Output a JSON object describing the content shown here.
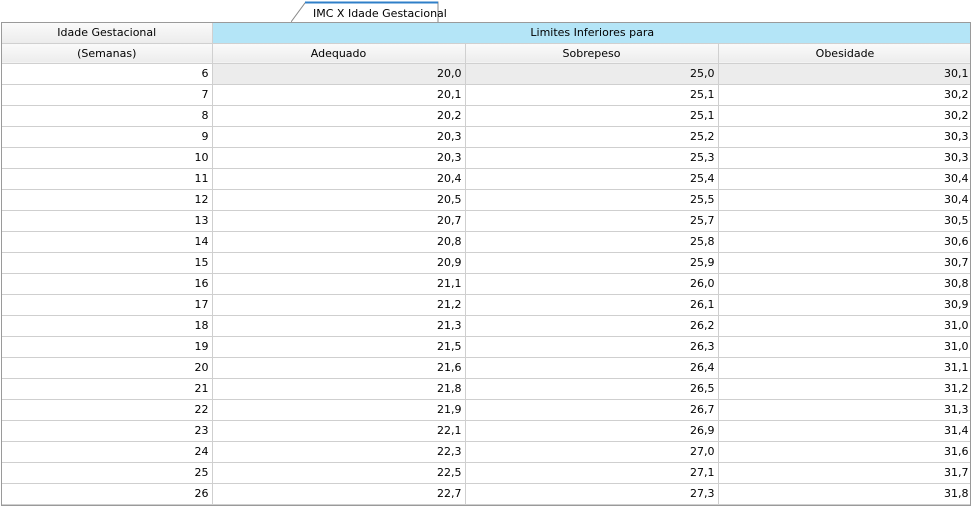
{
  "tab": {
    "label": "IMC X Idade Gestacional"
  },
  "header": {
    "col0_top": "Idade Gestacional",
    "col0_bottom": "(Semanas)",
    "group_label": "Limites Inferiores para",
    "columns": [
      "Adequado",
      "Sobrepeso",
      "Obesidade"
    ]
  },
  "rows": [
    {
      "semana": "6",
      "adequado": "20,0",
      "sobrepeso": "25,0",
      "obesidade": "30,1"
    },
    {
      "semana": "7",
      "adequado": "20,1",
      "sobrepeso": "25,1",
      "obesidade": "30,2"
    },
    {
      "semana": "8",
      "adequado": "20,2",
      "sobrepeso": "25,1",
      "obesidade": "30,2"
    },
    {
      "semana": "9",
      "adequado": "20,3",
      "sobrepeso": "25,2",
      "obesidade": "30,3"
    },
    {
      "semana": "10",
      "adequado": "20,3",
      "sobrepeso": "25,3",
      "obesidade": "30,3"
    },
    {
      "semana": "11",
      "adequado": "20,4",
      "sobrepeso": "25,4",
      "obesidade": "30,4"
    },
    {
      "semana": "12",
      "adequado": "20,5",
      "sobrepeso": "25,5",
      "obesidade": "30,4"
    },
    {
      "semana": "13",
      "adequado": "20,7",
      "sobrepeso": "25,7",
      "obesidade": "30,5"
    },
    {
      "semana": "14",
      "adequado": "20,8",
      "sobrepeso": "25,8",
      "obesidade": "30,6"
    },
    {
      "semana": "15",
      "adequado": "20,9",
      "sobrepeso": "25,9",
      "obesidade": "30,7"
    },
    {
      "semana": "16",
      "adequado": "21,1",
      "sobrepeso": "26,0",
      "obesidade": "30,8"
    },
    {
      "semana": "17",
      "adequado": "21,2",
      "sobrepeso": "26,1",
      "obesidade": "30,9"
    },
    {
      "semana": "18",
      "adequado": "21,3",
      "sobrepeso": "26,2",
      "obesidade": "31,0"
    },
    {
      "semana": "19",
      "adequado": "21,5",
      "sobrepeso": "26,3",
      "obesidade": "31,0"
    },
    {
      "semana": "20",
      "adequado": "21,6",
      "sobrepeso": "26,4",
      "obesidade": "31,1"
    },
    {
      "semana": "21",
      "adequado": "21,8",
      "sobrepeso": "26,5",
      "obesidade": "31,2"
    },
    {
      "semana": "22",
      "adequado": "21,9",
      "sobrepeso": "26,7",
      "obesidade": "31,3"
    },
    {
      "semana": "23",
      "adequado": "22,1",
      "sobrepeso": "26,9",
      "obesidade": "31,4"
    },
    {
      "semana": "24",
      "adequado": "22,3",
      "sobrepeso": "27,0",
      "obesidade": "31,6"
    },
    {
      "semana": "25",
      "adequado": "22,5",
      "sobrepeso": "27,1",
      "obesidade": "31,7"
    },
    {
      "semana": "26",
      "adequado": "22,7",
      "sobrepeso": "27,3",
      "obesidade": "31,8"
    }
  ]
}
